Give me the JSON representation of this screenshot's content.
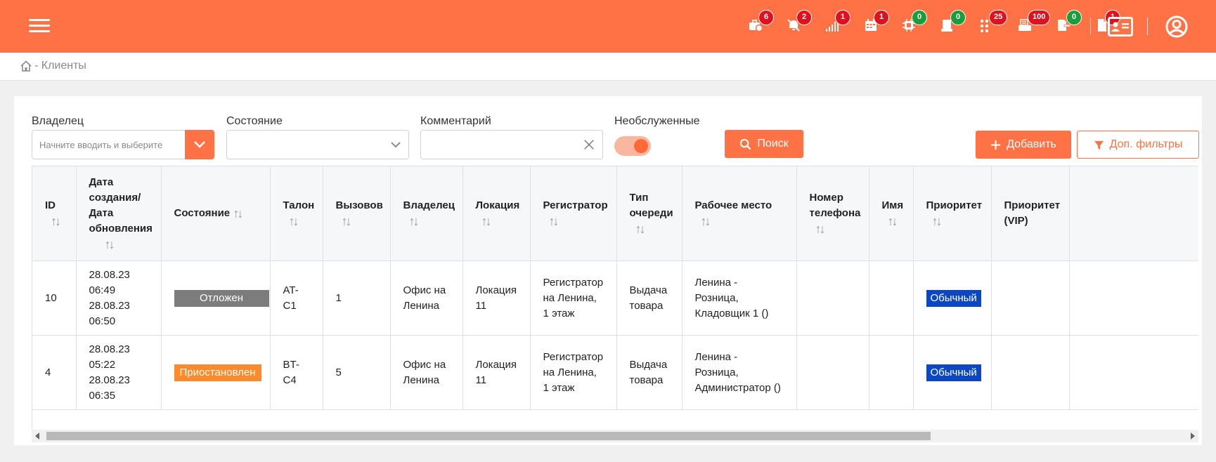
{
  "header": {
    "colors": {
      "bar": "#ff7245",
      "badge_red": "#e20f1e",
      "badge_green": "#1a9e3c"
    },
    "notifications": [
      {
        "icon": "briefcase-clock-icon",
        "count": "6",
        "color": "red"
      },
      {
        "icon": "bell-off-icon",
        "count": "2",
        "color": "red"
      },
      {
        "icon": "signal-bars-icon",
        "count": "1",
        "color": "red"
      },
      {
        "icon": "calendar-icon",
        "count": "1",
        "color": "red"
      },
      {
        "icon": "chip-icon",
        "count": "0",
        "color": "green"
      },
      {
        "icon": "terminal-icon",
        "count": "0",
        "color": "green"
      },
      {
        "icon": "grid-dots-icon",
        "count": "25",
        "color": "red"
      },
      {
        "icon": "printer-icon",
        "count": "100",
        "color": "red"
      },
      {
        "icon": "doc-export-icon",
        "count": "0",
        "color": "green"
      },
      {
        "icon": "document-icon",
        "count": "1",
        "color": "red"
      }
    ]
  },
  "breadcrumb": {
    "current": "- Клиенты"
  },
  "filters": {
    "owner_label": "Владелец",
    "owner_placeholder": "Начните вводить и выберите",
    "state_label": "Состояние",
    "comment_label": "Комментарий",
    "unserved_label": "Необслуженные",
    "search_button": "Поиск",
    "add_button": "Добавить",
    "more_filters_button": "Доп. фильтры"
  },
  "table": {
    "columns": [
      "ID",
      "Дата создания/ Дата обновления",
      "Состояние",
      "Талон",
      "Вызовов",
      "Владелец",
      "Локация",
      "Регистратор",
      "Тип очереди",
      "Рабочее место",
      "Номер телефона",
      "Имя",
      "Приоритет",
      "Приоритет (VIP)"
    ],
    "rows": [
      {
        "id": "10",
        "date": "28.08.23 06:49 28.08.23 06:50",
        "state": "Отложен",
        "ticket": "AT-C1",
        "calls": "1",
        "owner": "Офис на Ленина",
        "location": "Локация 11",
        "registrar": "Регистратор на Ленина, 1 этаж",
        "queue_type": "Выдача товара",
        "workplace": "Ленина - Розница, Кладовщик 1 ()",
        "phone": "",
        "name": "",
        "priority": "Обычный",
        "vip": ""
      },
      {
        "id": "4",
        "date": "28.08.23 05:22 28.08.23 06:35",
        "state": "Приостановлен",
        "ticket": "BT-C4",
        "calls": "5",
        "owner": "Офис на Ленина",
        "location": "Локация 11",
        "registrar": "Регистратор на Ленина, 1 этаж",
        "queue_type": "Выдача товара",
        "workplace": "Ленина - Розница, Администратор ()",
        "phone": "",
        "name": "",
        "priority": "Обычный",
        "vip": ""
      }
    ]
  }
}
